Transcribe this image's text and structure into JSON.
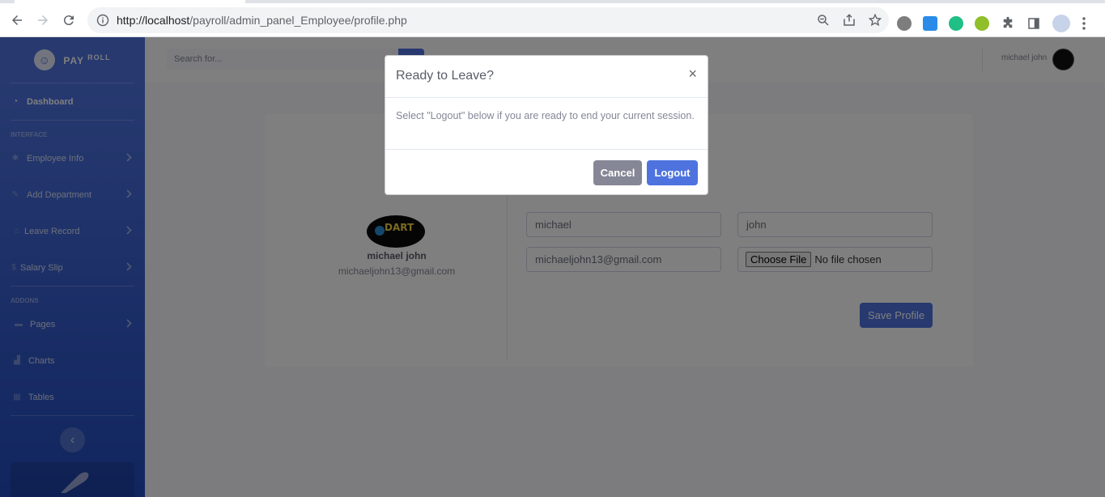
{
  "browser": {
    "url_host": "http://localhost",
    "url_path": "/payroll/admin_panel_Employee/profile.php"
  },
  "brand": {
    "name": "PAY",
    "sup": "ROLL"
  },
  "sidebar": {
    "dashboard": "Dashboard",
    "heading_interface": "INTERFACE",
    "items_interface": [
      "Employee Info",
      "Add Department",
      "Leave Record",
      "Salary Slip"
    ],
    "heading_addons": "ADDONS",
    "items_addons": [
      "Pages",
      "Charts",
      "Tables"
    ]
  },
  "topbar": {
    "search_placeholder": "Search for...",
    "user_name": "michael john"
  },
  "profile": {
    "name": "michael john",
    "email": "michaeljohn13@gmail.com",
    "first_name_value": "michael",
    "last_name_value": "john",
    "email_value": "michaeljohn13@gmail.com",
    "file_button": "Choose File",
    "file_status": "No file chosen",
    "save_label": "Save Profile",
    "logo_text": "DART"
  },
  "modal": {
    "title": "Ready to Leave?",
    "close": "×",
    "body": "Select \"Logout\" below if you are ready to end your current session.",
    "cancel": "Cancel",
    "logout": "Logout"
  },
  "colors": {
    "primary": "#4e73df",
    "secondary": "#858796"
  }
}
